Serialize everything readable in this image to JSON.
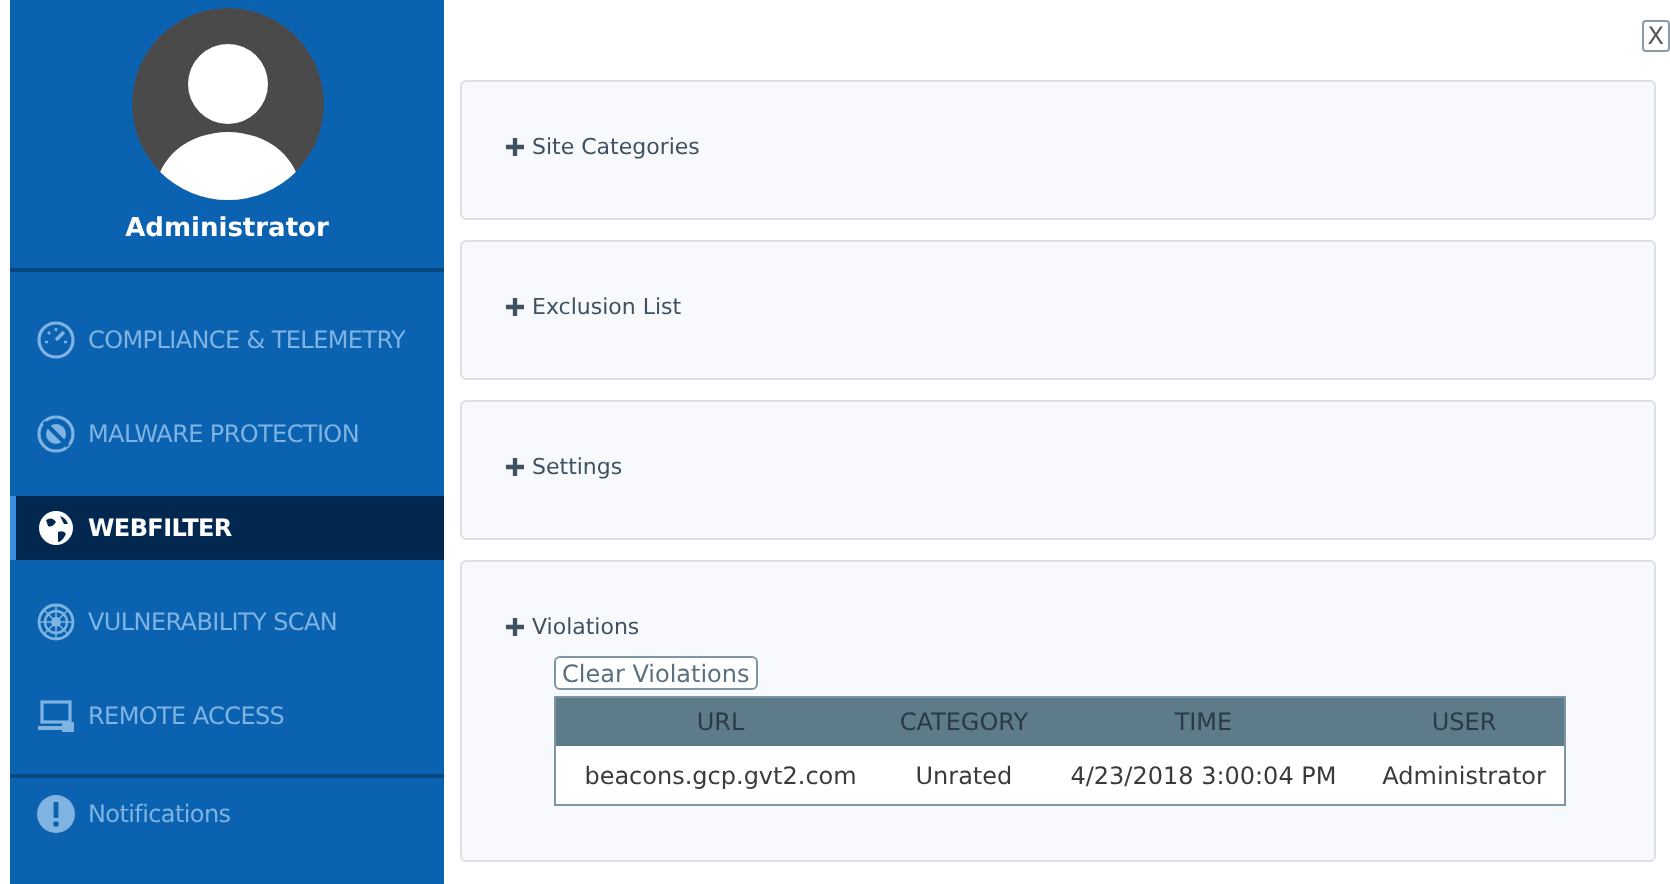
{
  "user": {
    "name": "Administrator"
  },
  "nav": [
    {
      "label": "COMPLIANCE & TELEMETRY",
      "kind": "gauge",
      "selected": false
    },
    {
      "label": "MALWARE PROTECTION",
      "kind": "shield",
      "selected": false
    },
    {
      "label": "WEBFILTER",
      "kind": "globe",
      "selected": true
    },
    {
      "label": "VULNERABILITY SCAN",
      "kind": "radar",
      "selected": false
    },
    {
      "label": "REMOTE ACCESS",
      "kind": "computer",
      "selected": false
    }
  ],
  "footer_nav": [
    {
      "label": "Notifications",
      "kind": "alert"
    }
  ],
  "close": "X",
  "sections": [
    {
      "title": "Site Categories"
    },
    {
      "title": "Exclusion List"
    },
    {
      "title": "Settings"
    },
    {
      "title": "Violations",
      "button": "Clear Violations",
      "table": {
        "columns": [
          "URL",
          "CATEGORY",
          "TIME",
          "USER"
        ],
        "rows": [
          [
            "beacons.gcp.gvt2.com",
            "Unrated",
            "4/23/2018 3:00:04 PM",
            "Administrator"
          ]
        ]
      }
    }
  ]
}
